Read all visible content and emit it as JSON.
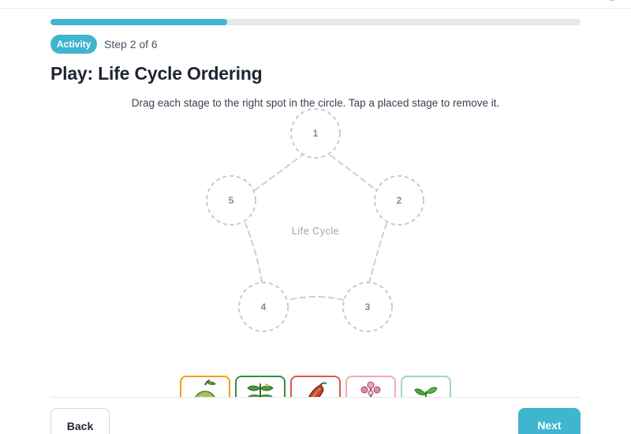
{
  "progress": {
    "value": 0.333
  },
  "header": {
    "badge": "Activity",
    "step": "Step 2 of 6"
  },
  "title": "Play: Life Cycle Ordering",
  "instructions": "Drag each stage to the right spot in the circle. Tap a placed stage to remove it.",
  "cycle": {
    "center_label": "Life Cycle",
    "slots": [
      {
        "label": "1"
      },
      {
        "label": "2"
      },
      {
        "label": "3"
      },
      {
        "label": "4"
      },
      {
        "label": "5"
      }
    ]
  },
  "stages": [
    {
      "icon": "pear-fruit-icon",
      "border": "#f59e0b"
    },
    {
      "icon": "leafy-plant-icon",
      "border": "#2f8f46"
    },
    {
      "icon": "seed-pod-icon",
      "border": "#e05555"
    },
    {
      "icon": "flowering-plant-icon",
      "border": "#f2a7b5"
    },
    {
      "icon": "sprout-icon",
      "border": "#9fd6bb"
    }
  ],
  "footer": {
    "back_label": "Back",
    "next_label": "Next"
  },
  "colors": {
    "accent": "#3fb5cf",
    "slot_border": "#c9c9c9"
  }
}
